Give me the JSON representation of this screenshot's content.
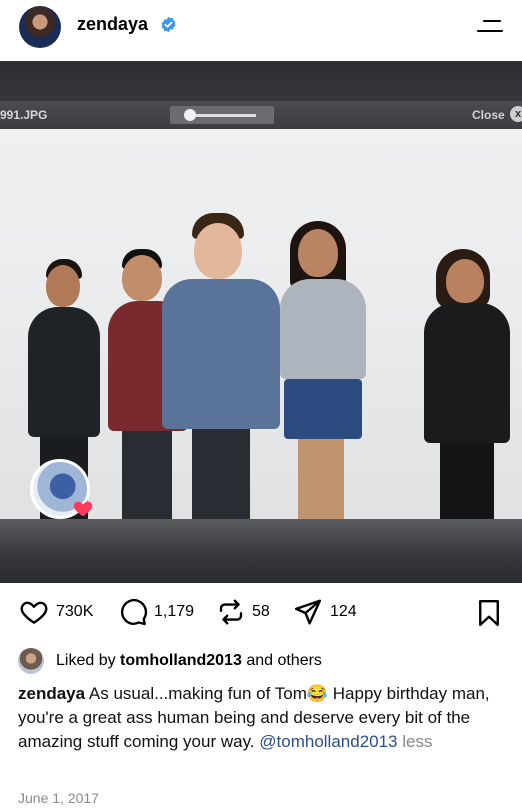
{
  "header": {
    "username": "zendaya",
    "verified_icon": "verified-badge-icon",
    "menu_icon": "menu-icon"
  },
  "photo": {
    "filename": "991.JPG",
    "close_label": "Close",
    "close_icon": "x",
    "story_badge_icon": "heart-icon"
  },
  "actions": {
    "likes": "730K",
    "comments": "1,179",
    "reposts": "58",
    "shares": "124",
    "icons": [
      "heart-icon",
      "comment-icon",
      "repost-icon",
      "share-icon",
      "bookmark-icon"
    ]
  },
  "liked_by": {
    "prefix": "Liked by",
    "user": "tomholland2013",
    "suffix": "and others"
  },
  "caption": {
    "author": "zendaya",
    "text_1": "As usual...making fun of Tom",
    "emoji": "😂",
    "text_2": "Happy birthday man, you're a great ass human being and deserve every bit of the amazing stuff coming your way.",
    "mention": "@tomholland2013",
    "less": "less"
  },
  "date": "June 1, 2017",
  "colors": {
    "verified": "#3897f0",
    "mention": "#2b4f8f",
    "muted": "#8a8a8a",
    "story_heart": "#ff3b5c"
  }
}
